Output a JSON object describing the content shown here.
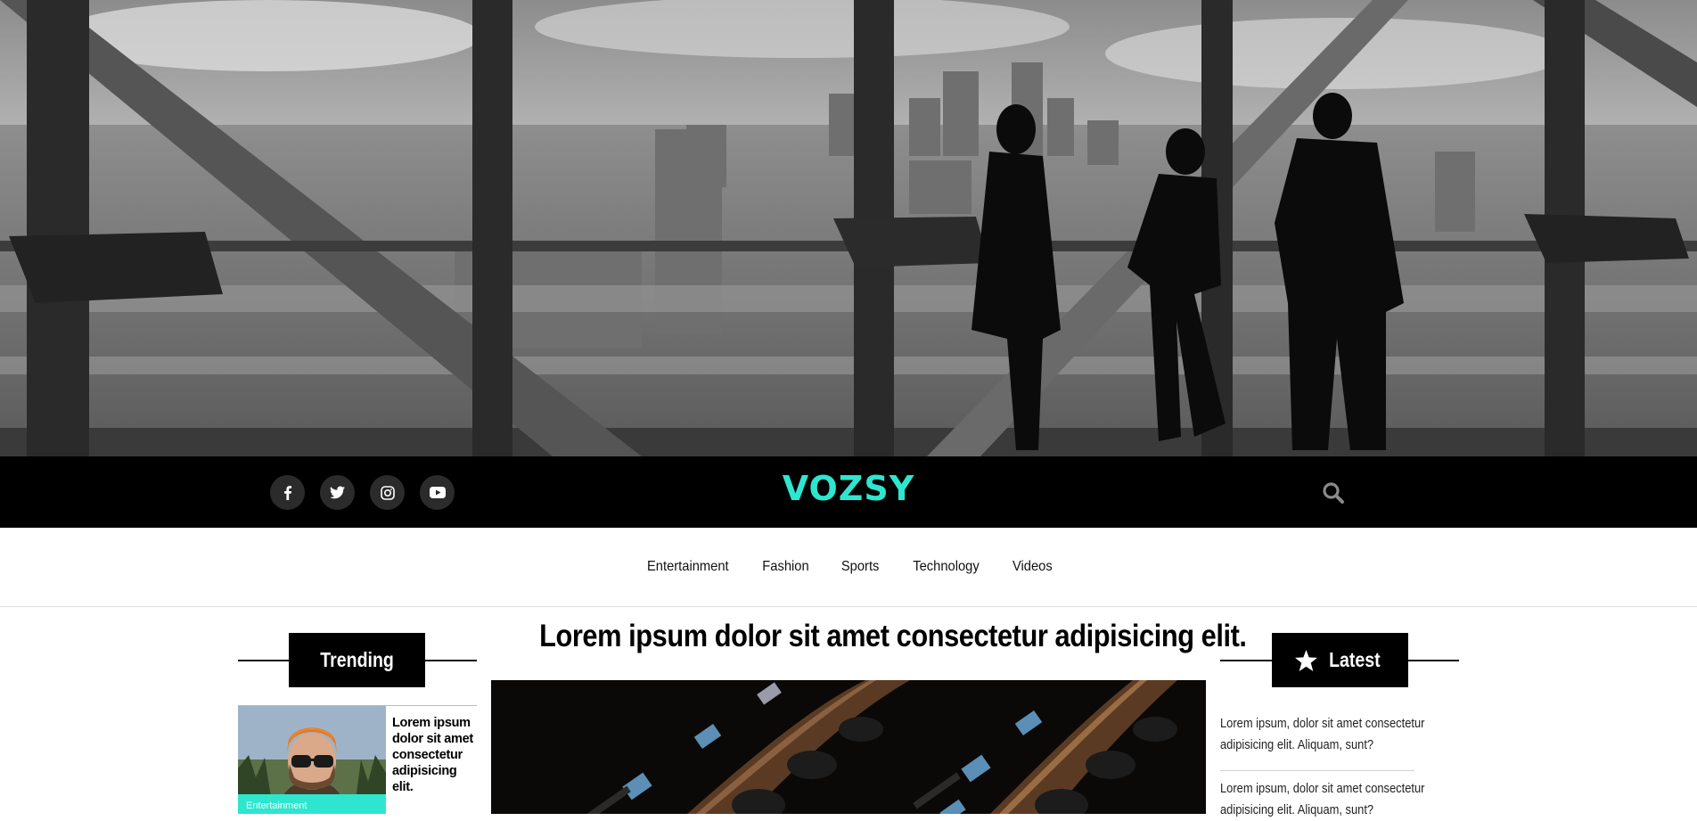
{
  "brand": {
    "logo": "VOZSY",
    "accent": "#2ee6cf"
  },
  "social": [
    {
      "name": "facebook",
      "icon": "facebook-icon"
    },
    {
      "name": "twitter",
      "icon": "twitter-icon"
    },
    {
      "name": "instagram",
      "icon": "instagram-icon"
    },
    {
      "name": "youtube",
      "icon": "youtube-icon"
    }
  ],
  "search": {
    "icon": "search-icon"
  },
  "nav": {
    "items": [
      "Entertainment",
      "Fashion",
      "Sports",
      "Technology",
      "Videos"
    ]
  },
  "trending": {
    "heading": "Trending",
    "articles": [
      {
        "tag": "Entertainment",
        "title": "Lorem ipsum dolor sit amet consectetur adipisicing elit."
      }
    ]
  },
  "main": {
    "headline": "Lorem ipsum dolor sit amet consectetur adipisicing elit."
  },
  "latest": {
    "heading": "Latest",
    "icon": "star-icon",
    "articles": [
      {
        "line1": "Lorem ipsum, dolor sit amet consectetur",
        "line2": "adipisicing elit. Aliquam, sunt?"
      },
      {
        "line1": "Lorem ipsum, dolor sit amet consectetur",
        "line2": "adipisicing elit. Aliquam, sunt?"
      }
    ]
  }
}
